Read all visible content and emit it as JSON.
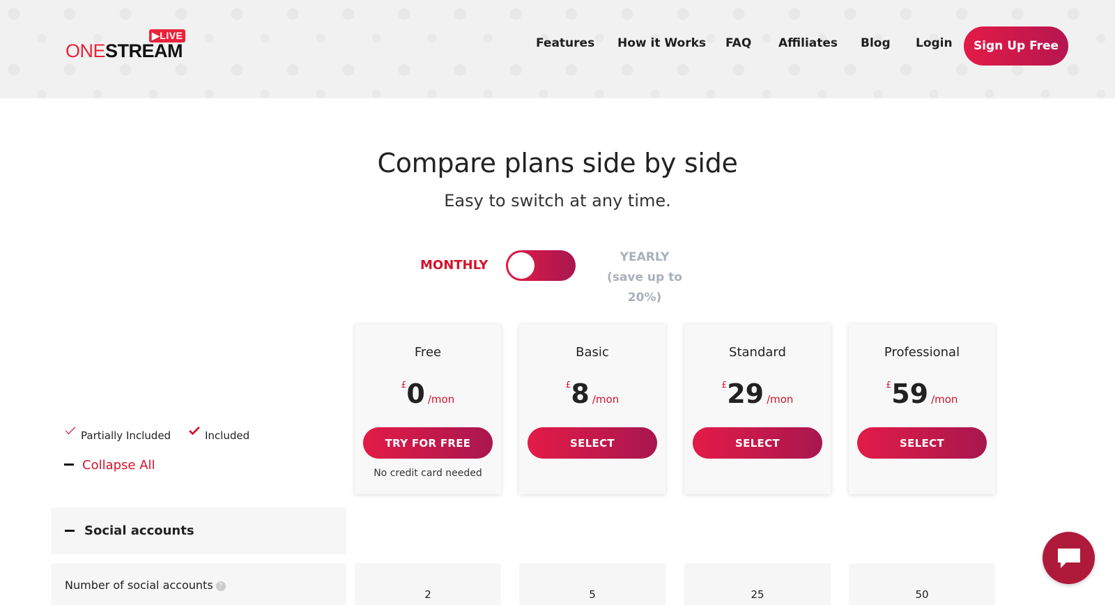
{
  "brand": {
    "logo_live": "LIVE",
    "logo_one": "ONE",
    "logo_stream": "STREAM"
  },
  "nav": {
    "items": [
      "Features",
      "How it Works",
      "FAQ",
      "Affiliates",
      "Blog",
      "Login"
    ],
    "signup": "Sign Up Free"
  },
  "hero": {
    "title": "Compare plans side by side",
    "subtitle": "Easy to switch at any time."
  },
  "billing": {
    "monthly": "MONTHLY",
    "yearly": "YEARLY",
    "yearly_note": "(save up to 20%)"
  },
  "legend": {
    "partial": "Partially Included",
    "included": "Included",
    "collapse": "Collapse All"
  },
  "plans": [
    {
      "name": "Free",
      "currency": "£",
      "amount": "0",
      "per": "/mon",
      "button": "TRY FOR FREE",
      "note": "No credit card needed"
    },
    {
      "name": "Basic",
      "currency": "£",
      "amount": "8",
      "per": "/mon",
      "button": "SELECT",
      "note": ""
    },
    {
      "name": "Standard",
      "currency": "£",
      "amount": "29",
      "per": "/mon",
      "button": "SELECT",
      "note": ""
    },
    {
      "name": "Professional",
      "currency": "£",
      "amount": "59",
      "per": "/mon",
      "button": "SELECT",
      "note": ""
    }
  ],
  "sections": {
    "social": {
      "label": "Social accounts",
      "rows": [
        {
          "label": "Number of social accounts",
          "values": [
            "2",
            "5",
            "25",
            "50"
          ]
        }
      ]
    }
  },
  "colors": {
    "accent": "#e31b47",
    "accent_dark": "#a8174f",
    "muted": "#aab0bb"
  },
  "icons": {
    "chat": "chat-bubble-icon",
    "help": "question-circle-icon"
  }
}
